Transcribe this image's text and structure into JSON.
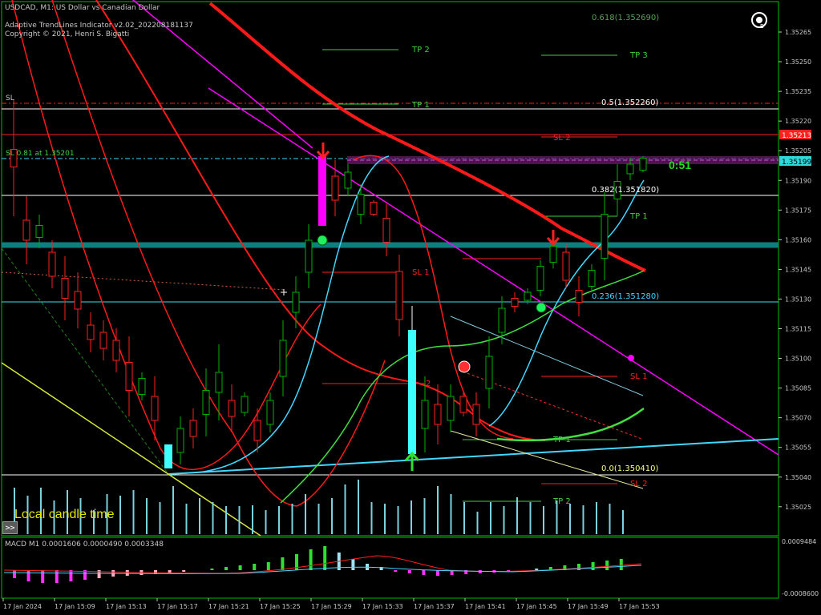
{
  "header": {
    "symbol_line": "USDCAD, M1:  US Dollar vs Canadian Dollar",
    "indicator_line": "Adaptive TrendLines Indicator v2.02_202208181137",
    "copyright_line": "Copyright © 2021, Henri S. Bigatti"
  },
  "price_axis": {
    "ticks": [
      "1.35265",
      "1.35250",
      "1.35235",
      "1.35220",
      "1.35205",
      "1.35190",
      "1.35175",
      "1.35160",
      "1.35145",
      "1.35130",
      "1.35115",
      "1.35100",
      "1.35085",
      "1.35070",
      "1.35055",
      "1.35040",
      "1.35025"
    ],
    "bid_badge": "1.35199",
    "red_badge": "1.35213"
  },
  "macd_axis": {
    "top": "0.0009484",
    "bottom": "-0.0008600"
  },
  "macd_label": "MACD M1 0.0001606 0.0000490 0.0003348",
  "time_axis": [
    "17 Jan 2024",
    "17 Jan 15:09",
    "17 Jan 15:13",
    "17 Jan 15:17",
    "17 Jan 15:21",
    "17 Jan 15:25",
    "17 Jan 15:29",
    "17 Jan 15:33",
    "17 Jan 15:37",
    "17 Jan 15:41",
    "17 Jan 15:45",
    "17 Jan 15:49",
    "17 Jan 15:53"
  ],
  "fib_levels": {
    "f618": "0.618(1.352690)",
    "f500": "0.5(1.352260)",
    "f382": "0.382(1.351820)",
    "f236": "0.236(1.351280)",
    "f000": "0.0(1.350410)"
  },
  "labels": {
    "tp2_top": "TP 2",
    "tp3": "TP 3",
    "tp1_top": "TP 1",
    "sl2_top": "SL 2",
    "tp1_mid": "TP 1",
    "sl1_mid": "SL 1",
    "sl1_right": "SL 1",
    "tp1_low": "TP 1",
    "sl2_low": "SL 2",
    "tp2_low": "TP 2",
    "num2": "2",
    "sl_left": "SL",
    "sl_info": "SL 0.81 at 1.35201"
  },
  "timer": "0:51",
  "local_time_label": "Local candle time",
  "scroll_button": ">>",
  "colors": {
    "background": "#000000",
    "grid_frame": "#00c000",
    "bull_candle": "#00b000",
    "bear_candle": "#ff2020",
    "magenta_line": "#ff00ff",
    "cyan_line": "#40d8ff",
    "red_curve": "#ff1a1a",
    "green_curve": "#40e040",
    "macd_positive": "#30e030",
    "macd_negative": "#ff30ff"
  },
  "icons": [
    "logo-icon",
    "down-arrow-icon",
    "up-arrow-icon",
    "signal-dot-icon"
  ]
}
